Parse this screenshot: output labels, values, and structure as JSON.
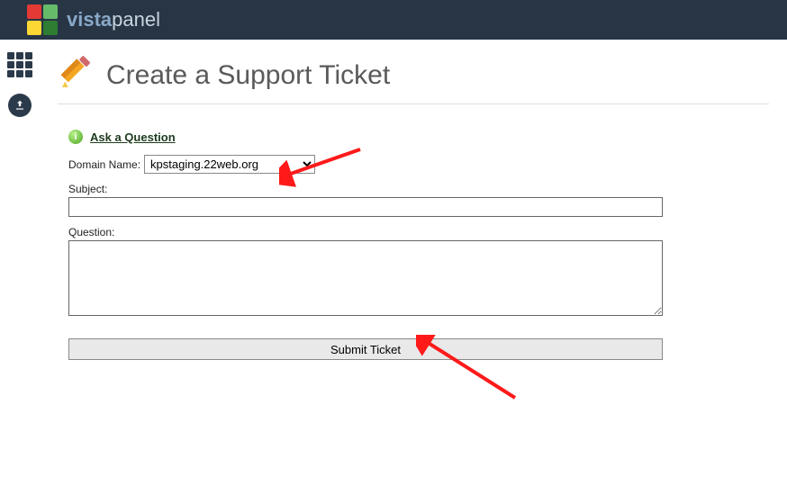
{
  "brand": {
    "prefix": "vista",
    "suffix": "panel"
  },
  "header": {
    "title": "Create a Support Ticket"
  },
  "ask": {
    "label": "Ask a Question"
  },
  "form": {
    "domain_label": "Domain Name:",
    "domain_selected": "kpstaging.22web.org",
    "subject_label": "Subject:",
    "subject_value": "",
    "question_label": "Question:",
    "question_value": "",
    "submit_label": "Submit Ticket"
  },
  "icons": {
    "pencil": "pencil-icon",
    "info": "info-icon",
    "grid": "apps-grid-icon",
    "upload": "upload-icon"
  }
}
